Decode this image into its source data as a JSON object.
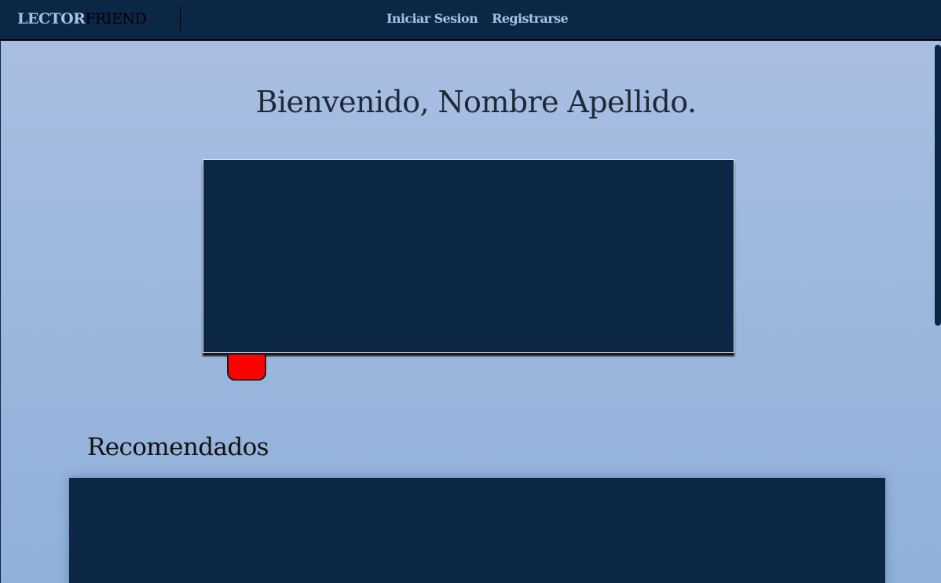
{
  "navbar": {
    "brand_part_1": "LECTOR",
    "brand_part_2": "FRIEND",
    "links": [
      "Iniciar Sesion",
      "Registrarse"
    ]
  },
  "main": {
    "welcome_text": "Bienvenido, Nombre Apellido.",
    "recommended_title": "Recomendados"
  },
  "colors": {
    "navbar_bg": "#0c2646",
    "accent_light": "#a9c1e8",
    "page_gradient_top": "#a9bde2",
    "page_gradient_bottom": "#8fb1d9",
    "panel_bg": "#0c2646",
    "red_tab": "#ff0000"
  }
}
